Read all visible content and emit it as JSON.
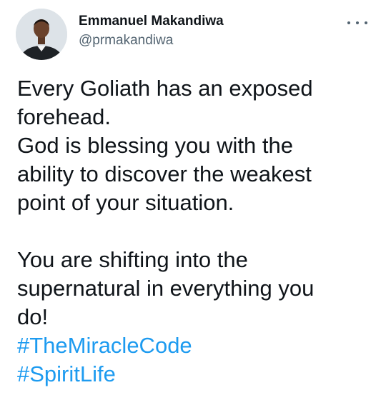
{
  "author": {
    "display_name": "Emmanuel Makandiwa",
    "handle": "@prmakandiwa",
    "avatar_icon": "profile-photo"
  },
  "tweet": {
    "paragraphs": [
      [
        "Every Goliath has an exposed",
        "forehead.",
        "God is blessing you with the",
        "ability to discover the weakest",
        "point of your situation."
      ],
      [
        "You are shifting into the",
        "supernatural in everything you",
        "do!"
      ]
    ],
    "hashtags": [
      "#TheMiracleCode",
      "#SpiritLife"
    ]
  },
  "menu": {
    "icon": "more-options-icon"
  },
  "colors": {
    "text": "#0f1419",
    "secondary": "#536471",
    "link": "#1d9bf0"
  }
}
